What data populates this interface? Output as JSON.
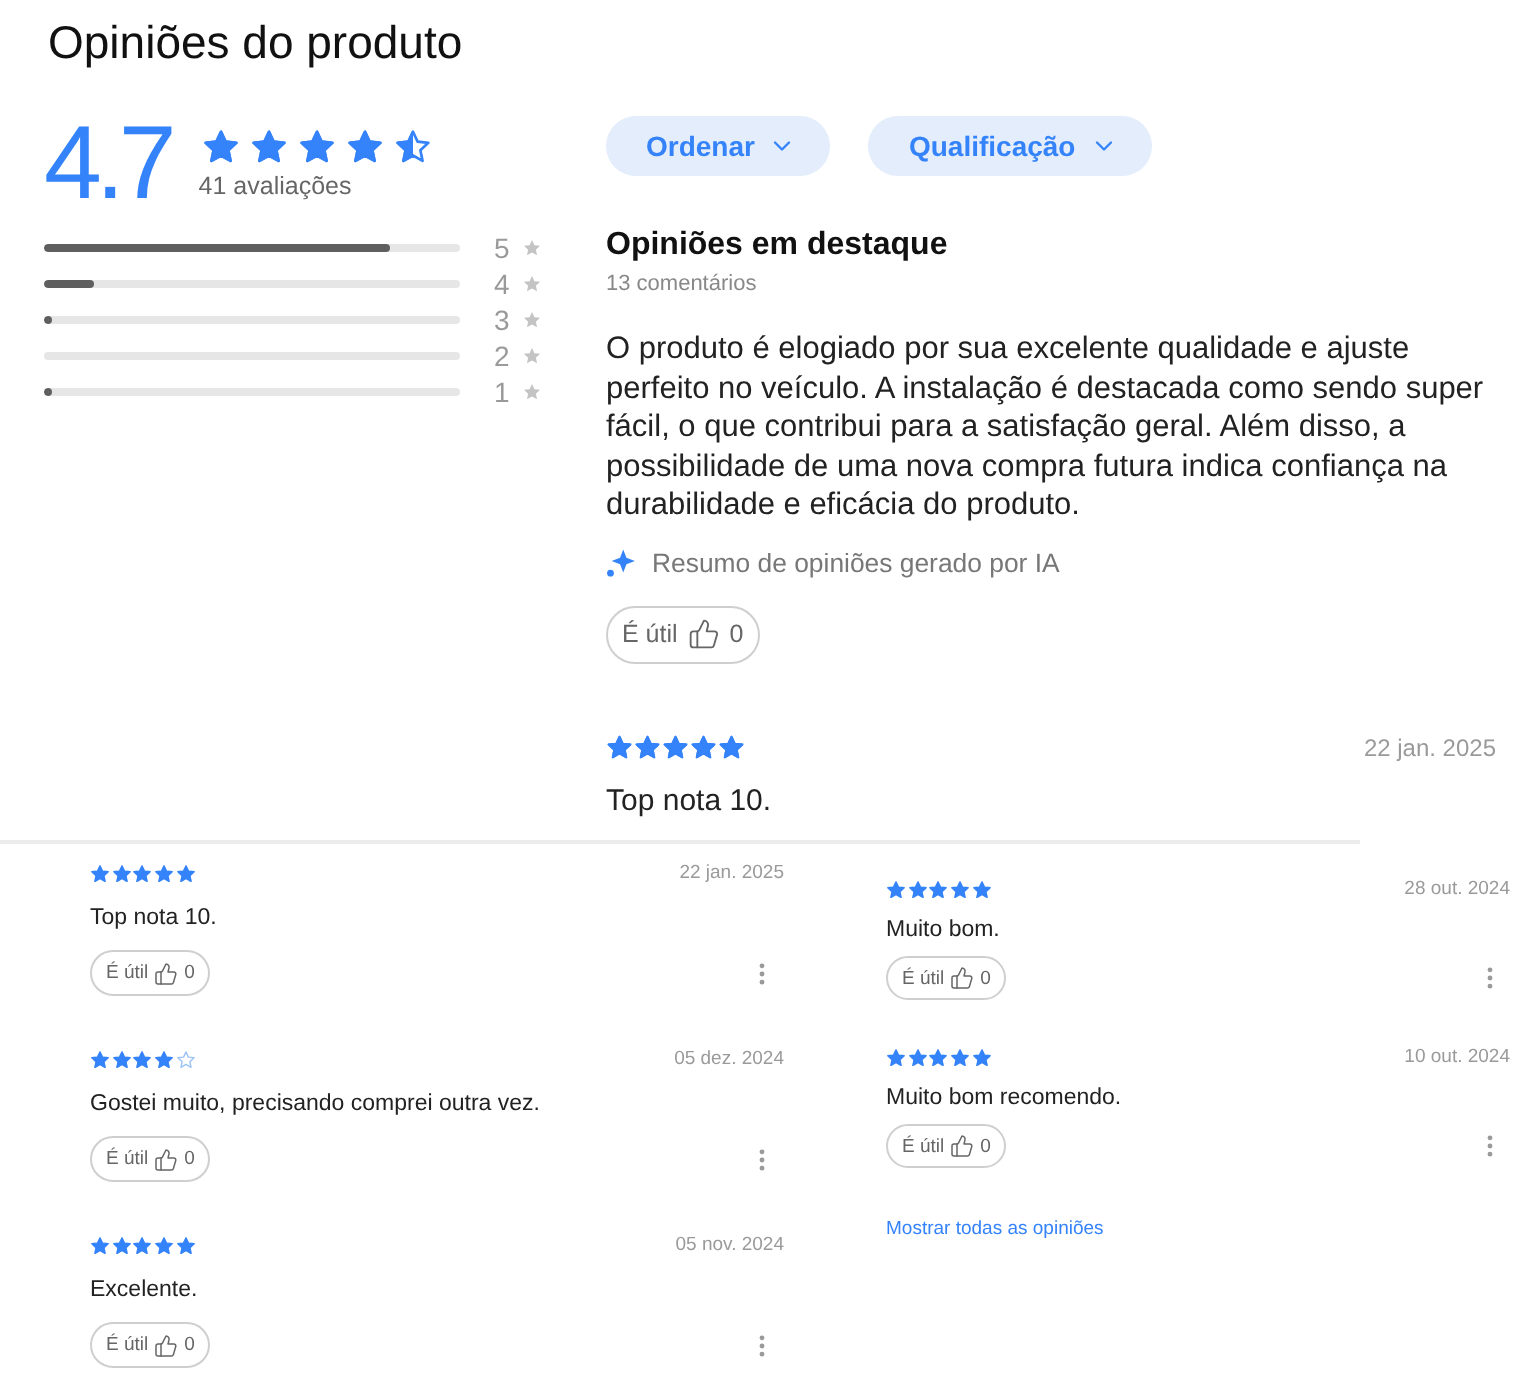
{
  "title": "Opiniões do produto",
  "summary": {
    "average": "4.7",
    "stars": 4.5,
    "count": "41 avaliações",
    "distribution": [
      {
        "label": "5",
        "level": 0.83
      },
      {
        "label": "4",
        "level": 0.12
      },
      {
        "label": "3",
        "level": 0.02
      },
      {
        "label": "2",
        "level": 0
      },
      {
        "label": "1",
        "level": 0.02
      }
    ]
  },
  "filters": [
    {
      "label": "Ordenar"
    },
    {
      "label": "Qualificação"
    }
  ],
  "highlights": {
    "title": "Opiniões em destaque",
    "count": "13 comentários",
    "text": "O produto é elogiado por sua excelente qualidade e ajuste perfeito no veículo. A instalação é destacada como sendo super fácil, o que contribui para a satisfação geral. Além disso, a possibilidade de uma nova compra futura indica confiança na durabilidade e eficácia do produto.",
    "ai_note": "Resumo de opiniões gerado por IA",
    "helpful": {
      "label": "É útil",
      "count": "0"
    }
  },
  "featured_review": {
    "stars": 5,
    "date": "22 jan. 2025",
    "text": "Top nota 10."
  },
  "review_columns": [
    {
      "reviews": [
        {
          "stars": 5,
          "date": "22 jan. 2025",
          "text": "Top nota 10.",
          "helpful": {
            "label": "É útil",
            "count": "0"
          }
        },
        {
          "stars": 4,
          "date": "05 dez. 2024",
          "text": "Gostei muito, precisando comprei outra vez.",
          "helpful": {
            "label": "É útil",
            "count": "0"
          }
        },
        {
          "stars": 5,
          "date": "05 nov. 2024",
          "text": "Excelente.",
          "helpful": {
            "label": "É útil",
            "count": "0"
          }
        }
      ]
    },
    {
      "reviews": [
        {
          "stars": 5,
          "date": "28 out. 2024",
          "text": "Muito bom.",
          "helpful": {
            "label": "É útil",
            "count": "0"
          }
        },
        {
          "stars": 5,
          "date": "10 out. 2024",
          "text": "Muito bom recomendo.",
          "helpful": {
            "label": "É útil",
            "count": "0"
          }
        }
      ],
      "link": "Mostrar todas as opiniões"
    }
  ]
}
